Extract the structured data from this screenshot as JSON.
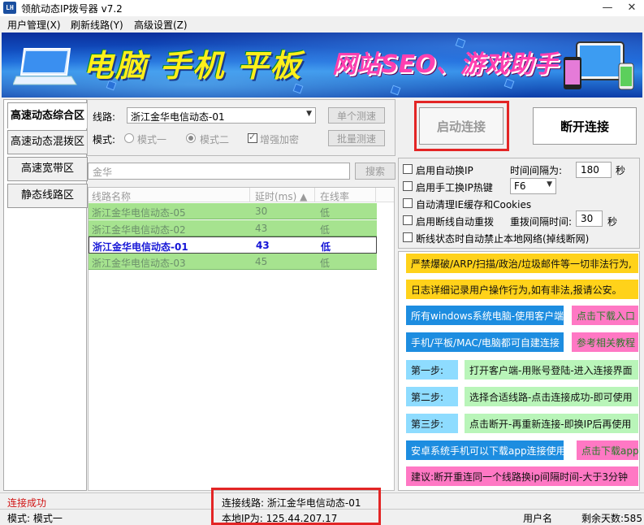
{
  "window": {
    "title": "领航动态IP拨号器 v7.2",
    "logo_text": "LH"
  },
  "menu": [
    "用户管理(X)",
    "刷新线路(Y)",
    "高级设置(Z)"
  ],
  "banner": {
    "slogan1": "电脑 手机 平板",
    "slogan2": "网站SEO、游戏助手"
  },
  "nav": [
    "高速动态综合区",
    "高速动态混拨区",
    "高速宽带区",
    "静态线路区"
  ],
  "line_panel": {
    "line_label": "线路:",
    "line_value": "浙江金华电信动态-01",
    "test_single": "单个测速",
    "test_batch": "批量测速",
    "mode_label": "模式:",
    "mode1": "模式一",
    "mode2": "模式二",
    "encrypt": "增强加密"
  },
  "search": {
    "value": "金华",
    "button": "搜索"
  },
  "list": {
    "headers": [
      "线路名称",
      "延时(ms) ▲",
      "在线率"
    ],
    "rows": [
      {
        "name": "浙江金华电信动态-05",
        "delay": "30",
        "rate": "低"
      },
      {
        "name": "浙江金华电信动态-02",
        "delay": "43",
        "rate": "低"
      },
      {
        "name": "浙江金华电信动态-01",
        "delay": "43",
        "rate": "低"
      },
      {
        "name": "浙江金华电信动态-03",
        "delay": "45",
        "rate": "低"
      }
    ]
  },
  "connect": {
    "start": "启动连接",
    "stop": "断开连接"
  },
  "options": {
    "auto_ip": "启用自动换IP",
    "interval_label": "时间间隔为:",
    "interval_value": "180",
    "sec": "秒",
    "hotkey": "启用手工换IP热键",
    "hotkey_value": "F6",
    "clean_ie": "自动清理IE缓存和Cookies",
    "redial": "启用断线自动重拨",
    "redial_label": "重拨间隔时间:",
    "redial_value": "30",
    "sec2": "秒",
    "block": "断线状态时自动禁止本地网络(掉线断网)"
  },
  "notices": {
    "n1": "严禁爆破/ARP/扫描/政治/垃圾邮件等一切非法行为,",
    "n2": "日志详细记录用户操作行为,如有非法,报请公安。",
    "n3": "所有windows系统电脑-使用客户端",
    "n3b": "点击下载入口",
    "n4": "手机/平板/MAC/电脑都可自建连接",
    "n4b": "参考相关教程",
    "s1": "第一步:",
    "s1t": "打开客户端-用账号登陆-进入连接界面",
    "s2": "第二步:",
    "s2t": "选择合适线路-点击连接成功-即可使用",
    "s3": "第三步:",
    "s3t": "点击断开-再重新连接-即换IP后再使用",
    "n5": "安卓系统手机可以下载app连接使用",
    "n5b": "点击下载app",
    "n6": "建议:断开重连同一个线路换ip间隔时间-大于3分钟"
  },
  "status": {
    "connected": "连接成功",
    "line": "连接线路: 浙江金华电信动态-01",
    "ip": "本地IP为: 125.44.207.17",
    "mode": "模式: 模式一",
    "user": "用户名",
    "days": "剩余天数:585"
  },
  "colors": {
    "accent_red": "#e32525",
    "list_green": "#a6e38f"
  }
}
